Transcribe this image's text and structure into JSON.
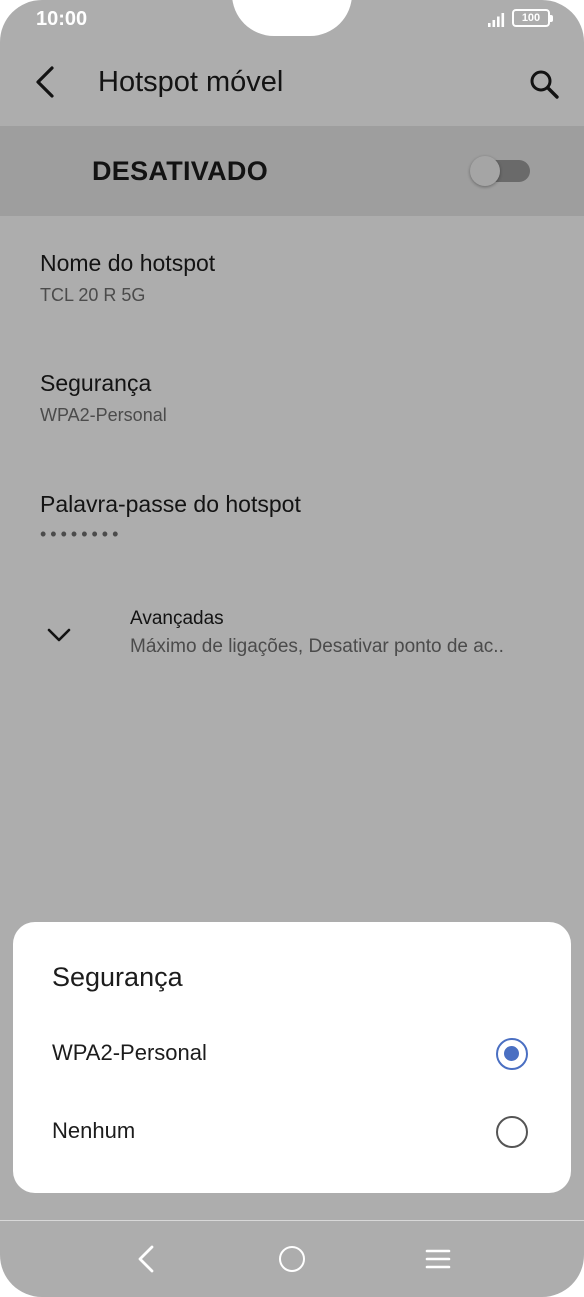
{
  "status": {
    "time": "10:00",
    "battery": "100"
  },
  "toolbar": {
    "title": "Hotspot móvel"
  },
  "master_switch": {
    "label": "DESATIVADO",
    "on": false
  },
  "settings": [
    {
      "title": "Nome do hotspot",
      "summary": "TCL 20 R 5G"
    },
    {
      "title": "Segurança",
      "summary": "WPA2-Personal"
    },
    {
      "title": "Palavra-passe do hotspot",
      "summary": "••••••••"
    }
  ],
  "advanced": {
    "title": "Avançadas",
    "summary": "Máximo de ligações, Desativar ponto de ac.."
  },
  "dialog": {
    "title": "Segurança",
    "options": [
      {
        "label": "WPA2-Personal",
        "selected": true
      },
      {
        "label": "Nenhum",
        "selected": false
      }
    ]
  },
  "colors": {
    "accent": "#4a6fc2",
    "switchbar_bg": "#e9e9e9",
    "scrim": "rgba(0,0,0,0.32)"
  },
  "icons": [
    "back-icon",
    "search-icon",
    "chevron-down-icon",
    "signal-icon",
    "battery-icon",
    "nav-back-icon",
    "nav-home-icon",
    "nav-menu-icon"
  ]
}
